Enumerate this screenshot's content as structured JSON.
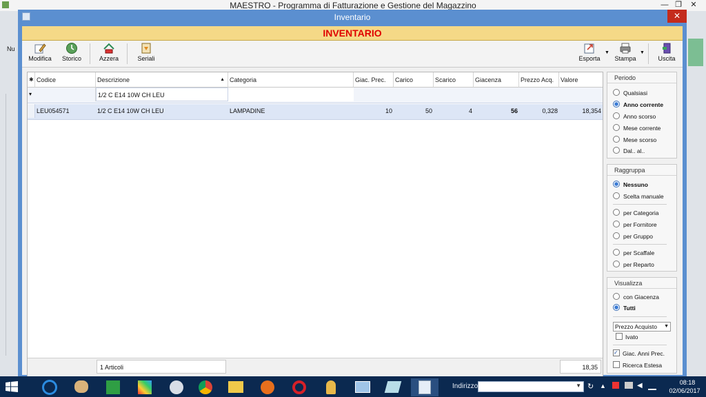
{
  "app": {
    "title": "MAESTRO - Programma di Fatturazione e Gestione del Magazzino",
    "min": "—",
    "max": "❐",
    "close": "✕"
  },
  "dialog": {
    "title": "Inventario",
    "close": "✕",
    "banner": "INVENTARIO"
  },
  "toolbar": {
    "modifica": "Modifica",
    "storico": "Storico",
    "azzera": "Azzera",
    "seriali": "Seriali",
    "esporta": "Esporta",
    "stampa": "Stampa",
    "uscita": "Uscita"
  },
  "grid": {
    "columns": [
      "Codice",
      "Descrizione",
      "Categoria",
      "Giac. Prec.",
      "Carico",
      "Scarico",
      "Giacenza",
      "Prezzo Acq.",
      "Valore"
    ],
    "filter": {
      "descrizione": "1/2  C  E14  10W  CH  LEU"
    },
    "rows": [
      {
        "codice": "LEU054571",
        "descrizione": "1/2  C  E14  10W  CH  LEU",
        "categoria": "LAMPADINE",
        "giac_prec": "10",
        "carico": "50",
        "scarico": "4",
        "giacenza": "56",
        "prezzo_acq": "0,328",
        "valore": "18,354"
      }
    ],
    "footer_count": "1 Articoli",
    "footer_total": "18,35"
  },
  "periodo": {
    "title": "Periodo",
    "options": [
      "Qualsiasi",
      "Anno corrente",
      "Anno scorso",
      "Mese corrente",
      "Mese scorso",
      "Dal.. al.."
    ],
    "selected": "Anno corrente"
  },
  "raggruppa": {
    "title": "Raggruppa",
    "options": [
      "Nessuno",
      "Scelta manuale",
      "per Categoria",
      "per Fornitore",
      "per Gruppo",
      "per Scaffale",
      "per Reparto"
    ],
    "selected": "Nessuno"
  },
  "visualizza": {
    "title": "Visualizza",
    "options": [
      "con Giacenza",
      "Tutti"
    ],
    "selected": "Tutti",
    "price_select": "Prezzo Acquisto",
    "ivato": "Ivato",
    "giac_anni_prec": "Giac. Anni Prec.",
    "ricerca_estesa": "Ricerca Estesa"
  },
  "taskbar": {
    "indirizzo_label": "Indirizzo",
    "time": "08:18",
    "date": "02/06/2017"
  },
  "colors": {
    "dialog_frame": "#5b8fd0",
    "banner_bg": "#f5d987",
    "banner_text": "#e00000",
    "selected_row": "#dde6f6",
    "close_button": "#c42b1c",
    "taskbar": "#0b2950"
  }
}
